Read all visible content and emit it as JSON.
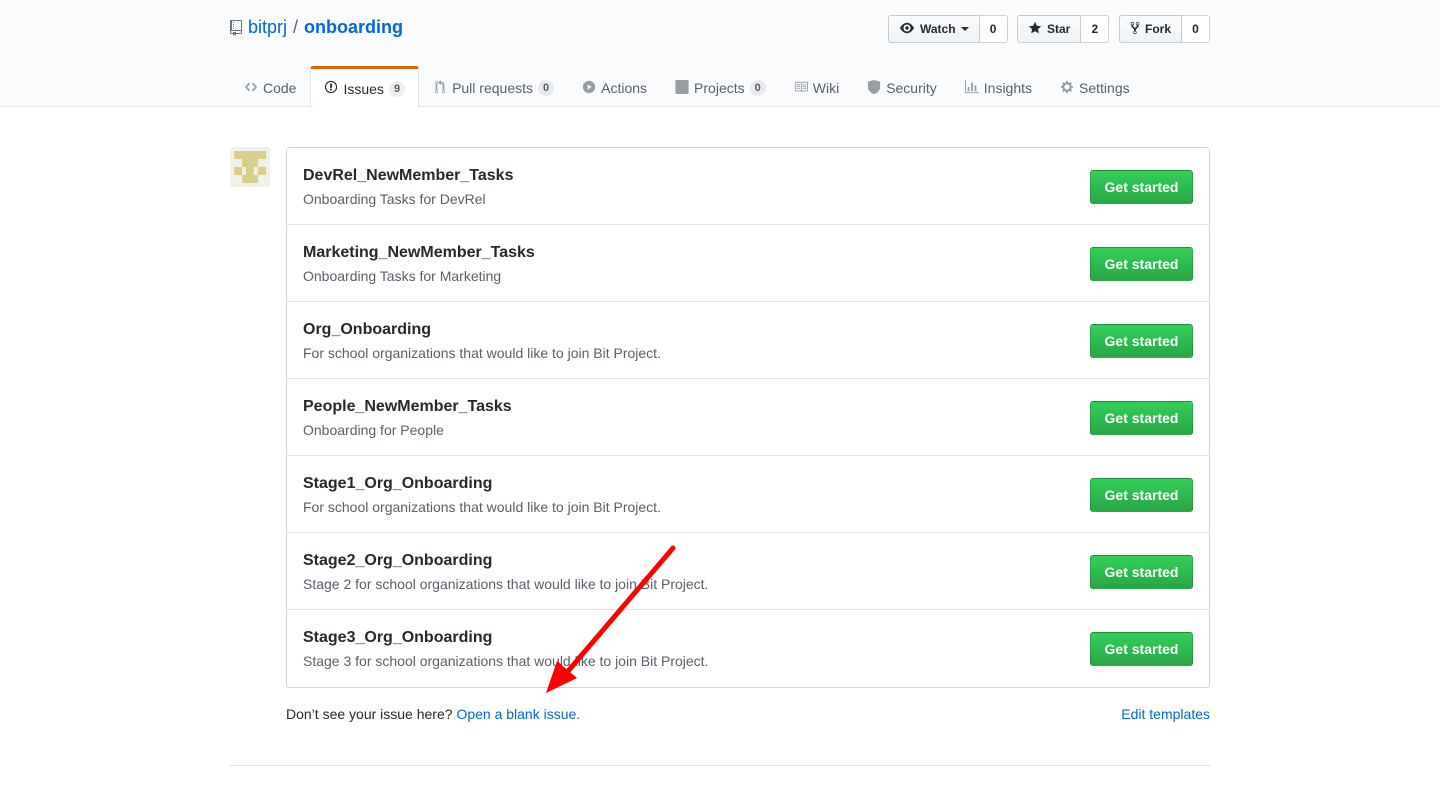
{
  "repo": {
    "owner": "bitprj",
    "separator": "/",
    "name": "onboarding"
  },
  "actions": {
    "watch": {
      "label": "Watch",
      "count": "0"
    },
    "star": {
      "label": "Star",
      "count": "2"
    },
    "fork": {
      "label": "Fork",
      "count": "0"
    }
  },
  "nav": {
    "code": "Code",
    "issues": "Issues",
    "issues_count": "9",
    "pulls": "Pull requests",
    "pulls_count": "0",
    "actions": "Actions",
    "projects": "Projects",
    "projects_count": "0",
    "wiki": "Wiki",
    "security": "Security",
    "insights": "Insights",
    "settings": "Settings"
  },
  "templates": [
    {
      "name": "DevRel_NewMember_Tasks",
      "description": "Onboarding Tasks for DevRel",
      "button": "Get started"
    },
    {
      "name": "Marketing_NewMember_Tasks",
      "description": "Onboarding Tasks for Marketing",
      "button": "Get started"
    },
    {
      "name": "Org_Onboarding",
      "description": "For school organizations that would like to join Bit Project.",
      "button": "Get started"
    },
    {
      "name": "People_NewMember_Tasks",
      "description": "Onboarding for People",
      "button": "Get started"
    },
    {
      "name": "Stage1_Org_Onboarding",
      "description": "For school organizations that would like to join Bit Project.",
      "button": "Get started"
    },
    {
      "name": "Stage2_Org_Onboarding",
      "description": "Stage 2 for school organizations that would like to join Bit Project.",
      "button": "Get started"
    },
    {
      "name": "Stage3_Org_Onboarding",
      "description": "Stage 3 for school organizations that would like to join Bit Project.",
      "button": "Get started"
    }
  ],
  "footer": {
    "prompt": "Don’t see your issue here?",
    "blank_link": "Open a blank issue.",
    "edit_link": "Edit templates"
  },
  "colors": {
    "accent_tab": "#e36209",
    "link": "#0366d6",
    "primary_button": "#28a745",
    "annotation": "#ff0000"
  }
}
